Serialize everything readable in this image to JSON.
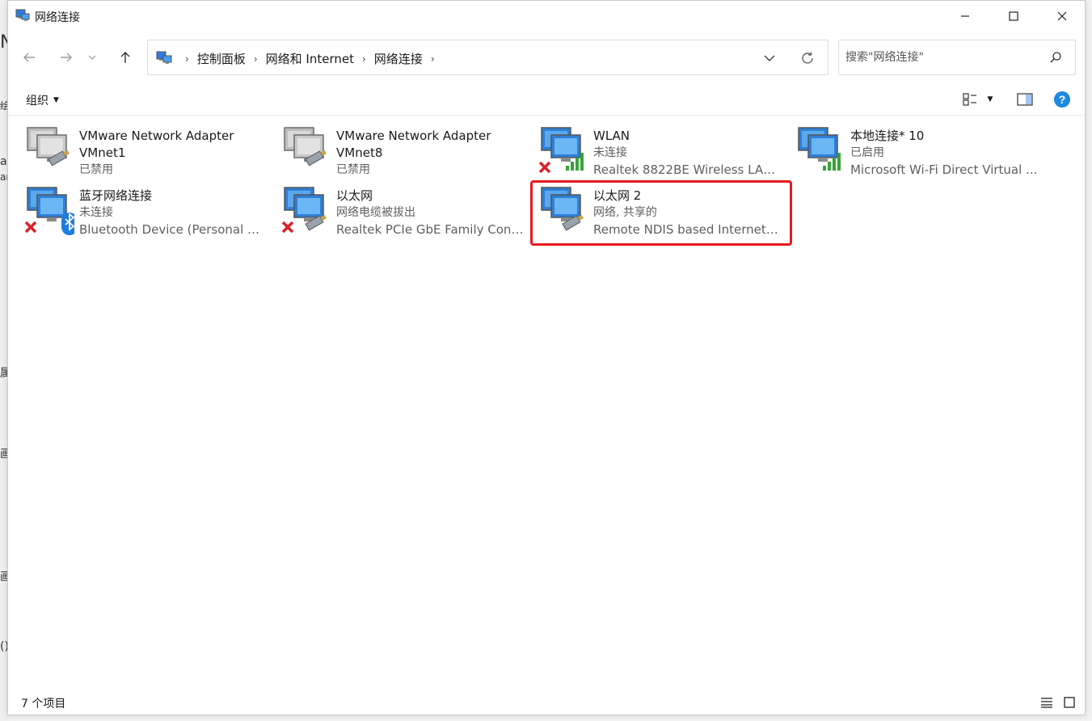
{
  "window": {
    "title": "网络连接"
  },
  "background_window": {
    "fragments": [
      "N",
      "绘",
      "a",
      "ar",
      "属",
      "画",
      "画",
      "()"
    ]
  },
  "navigation": {
    "breadcrumbs": [
      "控制面板",
      "网络和 Internet",
      "网络连接"
    ],
    "search_placeholder": "搜索\"网络连接\""
  },
  "toolbar": {
    "organize_label": "组织"
  },
  "connections": [
    {
      "name": "VMware Network Adapter VMnet1",
      "status": "已禁用",
      "device": "",
      "icon": "network-adapter-disabled-icon"
    },
    {
      "name": "VMware Network Adapter VMnet8",
      "status": "已禁用",
      "device": "",
      "icon": "network-adapter-disabled-icon"
    },
    {
      "name": "WLAN",
      "status": "未连接",
      "device": "Realtek 8822BE Wireless LAN ...",
      "icon": "wifi-adapter-disconnected-icon"
    },
    {
      "name": "本地连接* 10",
      "status": "已启用",
      "device": "Microsoft Wi-Fi Direct Virtual ...",
      "icon": "wifi-adapter-icon"
    },
    {
      "name": "蓝牙网络连接",
      "status": "未连接",
      "device": "Bluetooth Device (Personal Ar...",
      "icon": "bluetooth-adapter-disconnected-icon"
    },
    {
      "name": "以太网",
      "status": "网络电缆被拔出",
      "device": "Realtek PCIe GbE Family Contr...",
      "icon": "ethernet-adapter-disconnected-icon"
    },
    {
      "name": "以太网 2",
      "status": "网络, 共享的",
      "device": "Remote NDIS based Internet S...",
      "icon": "ethernet-adapter-icon"
    }
  ],
  "statusbar": {
    "item_count": "7 个项目"
  },
  "colors": {
    "highlight": "#e8191f",
    "help": "#1e88e5",
    "signal": "#3aa23a",
    "error": "#d9232a"
  }
}
